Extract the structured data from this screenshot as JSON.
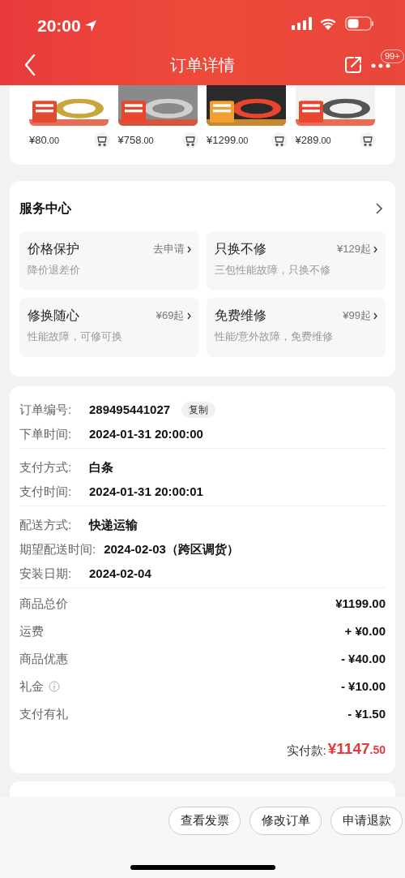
{
  "status_bar": {
    "time": "20:00"
  },
  "header": {
    "title": "订单详情",
    "badge": "99+"
  },
  "products": [
    {
      "price": "¥80",
      "decimal": ".00"
    },
    {
      "price": "¥758",
      "decimal": ".00"
    },
    {
      "price": "¥1299",
      "decimal": ".00"
    },
    {
      "price": "¥289",
      "decimal": ".00"
    }
  ],
  "service_center": {
    "title": "服务中心",
    "items": [
      {
        "name": "价格保护",
        "action": "去申请",
        "desc": "降价退差价"
      },
      {
        "name": "只换不修",
        "action": "¥129起",
        "desc": "三包性能故障，只换不修"
      },
      {
        "name": "修换随心",
        "action": "¥69起",
        "desc": "性能故障，可修可换"
      },
      {
        "name": "免费维修",
        "action": "¥99起",
        "desc": "性能/意外故障，免费维修"
      }
    ]
  },
  "order_info": {
    "groups": [
      [
        {
          "label": "订单编号:",
          "value": "289495441027",
          "copy": "复制"
        },
        {
          "label": "下单时间:",
          "value": "2024-01-31 20:00:00"
        }
      ],
      [
        {
          "label": "支付方式:",
          "value": "白条"
        },
        {
          "label": "支付时间:",
          "value": "2024-01-31 20:00:01"
        }
      ],
      [
        {
          "label": "配送方式:",
          "value": "快递运输"
        },
        {
          "label": "期望配送时间:",
          "value": "2024-02-03（跨区调货）"
        },
        {
          "label": "安装日期:",
          "value": "2024-02-04"
        }
      ]
    ],
    "amounts": [
      {
        "label": "商品总价",
        "value": "¥1199.00",
        "info": false
      },
      {
        "label": "运费",
        "value": "+ ¥0.00",
        "info": false
      },
      {
        "label": "商品优惠",
        "value": "- ¥40.00",
        "info": false
      },
      {
        "label": "礼金",
        "value": "- ¥10.00",
        "info": true
      },
      {
        "label": "支付有礼",
        "value": "- ¥1.50",
        "info": false
      }
    ],
    "total": {
      "label": "实付款:",
      "amount": "¥1147",
      "decimal": ".50"
    }
  },
  "bottom_buttons": [
    "查看发票",
    "修改订单",
    "申请退款"
  ]
}
